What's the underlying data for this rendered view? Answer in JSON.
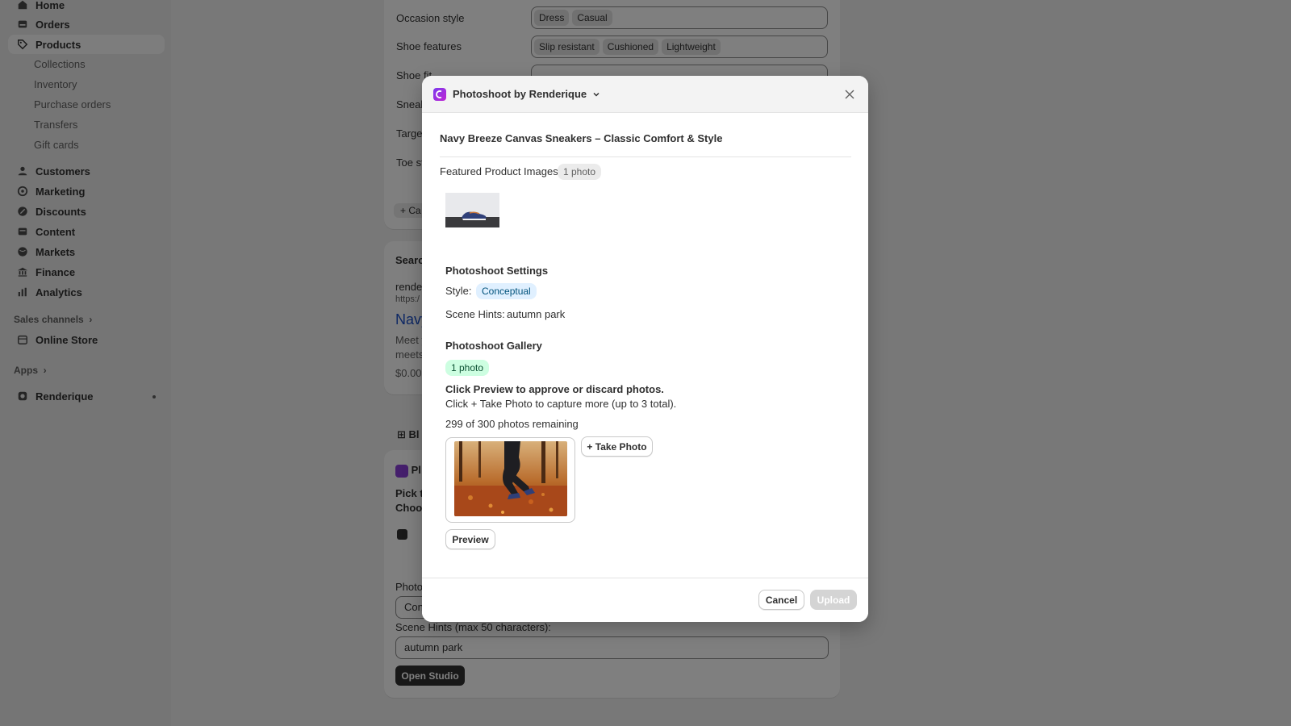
{
  "sidebar": {
    "items": [
      {
        "label": "Home",
        "icon": "home-icon"
      },
      {
        "label": "Orders",
        "icon": "inbox-icon"
      },
      {
        "label": "Products",
        "icon": "tag-icon"
      },
      {
        "label": "Customers",
        "icon": "person-icon"
      },
      {
        "label": "Marketing",
        "icon": "target-icon"
      },
      {
        "label": "Discounts",
        "icon": "discount-icon"
      },
      {
        "label": "Content",
        "icon": "content-icon"
      },
      {
        "label": "Markets",
        "icon": "globe-icon"
      },
      {
        "label": "Finance",
        "icon": "bank-icon"
      },
      {
        "label": "Analytics",
        "icon": "bar-chart-icon"
      }
    ],
    "product_subitems": [
      "Collections",
      "Inventory",
      "Purchase orders",
      "Transfers",
      "Gift cards"
    ],
    "sales_channels_label": "Sales channels",
    "online_store_label": "Online Store",
    "apps_label": "Apps",
    "app_label": "Renderique"
  },
  "background": {
    "occasion_label": "Occasion style",
    "occasion_chips": [
      "Dress",
      "Casual"
    ],
    "features_label": "Shoe features",
    "features_chips": [
      "Slip resistant",
      "Cushioned",
      "Lightweight"
    ],
    "fit_label": "Shoe fit",
    "sneaker_label": "Sneak",
    "target_label": "Targe",
    "toe_label": "Toe st",
    "add_label": "+ Ca",
    "search_label": "Searc",
    "seo_site": "rende",
    "seo_url": "https:/",
    "seo_title": "Navy",
    "seo_desc_1": "Meet y",
    "seo_desc_2": "meets",
    "seo_price": "$0.00",
    "blocks_label": "Bl",
    "block_app": "Pl",
    "pick_label": "Pick tl",
    "choose_label": "Choos",
    "photo_label": "Photo",
    "style_value": "Con",
    "scene_hints_label": "Scene Hints (max 50 characters):",
    "scene_hints_value": "autumn park",
    "open_studio": "Open Studio"
  },
  "modal": {
    "title": "Photoshoot by Renderique",
    "product_title": "Navy Breeze Canvas Sneakers – Classic Comfort & Style",
    "featured_label": "Featured Product Images",
    "featured_count": "1 photo",
    "settings_title": "Photoshoot Settings",
    "style_label": "Style:",
    "style_value": "Conceptual",
    "scene_label": "Scene Hints:",
    "scene_value": "autumn park",
    "gallery_title": "Photoshoot Gallery",
    "gallery_count": "1 photo",
    "instruction_1": "Click Preview to approve or discard photos.",
    "instruction_2": "Click + Take Photo to capture more (up to 3 total).",
    "remaining": "299 of 300 photos remaining",
    "take_photo": "+ Take Photo",
    "preview": "Preview",
    "cancel": "Cancel",
    "upload": "Upload"
  }
}
